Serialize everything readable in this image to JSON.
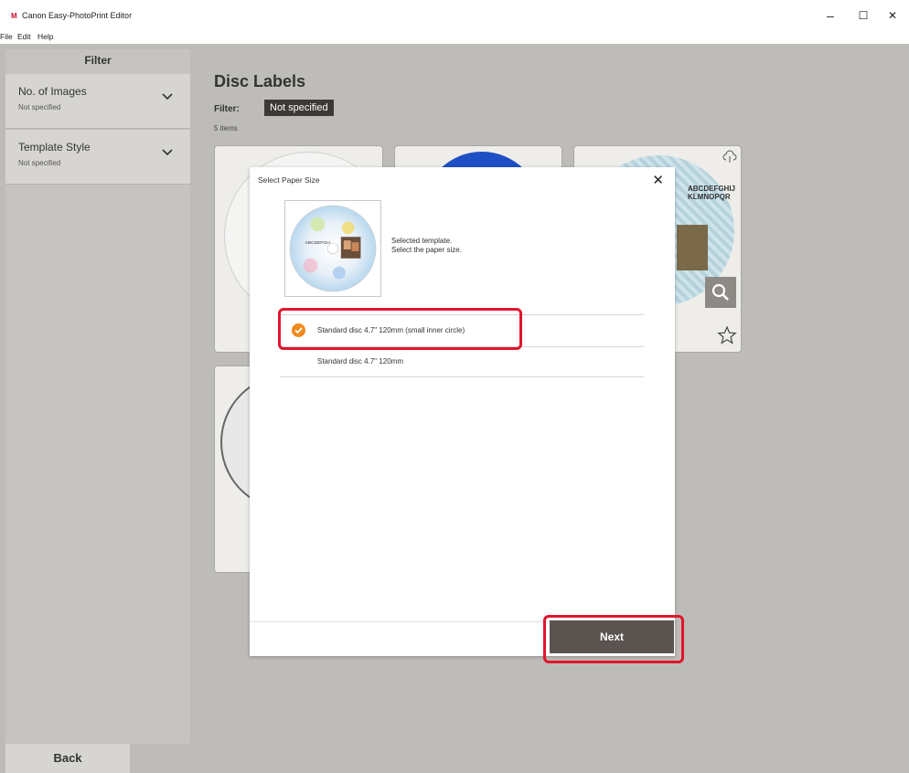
{
  "window": {
    "logo": "M",
    "title": "Canon Easy-PhotoPrint Editor",
    "minimize": "–",
    "maximize": "☐",
    "close": "✕"
  },
  "menu": [
    "File",
    "Edit",
    "Help"
  ],
  "sidebar": {
    "heading": "Filter",
    "filters": [
      {
        "title": "No. of Images",
        "value": "Not specified"
      },
      {
        "title": "Template Style",
        "value": "Not specified"
      }
    ]
  },
  "content": {
    "title": "Disc Labels",
    "filter_label": "Filter:",
    "filter_value": "Not specified",
    "count": "5 items"
  },
  "card_text": {
    "label_a": "ABCDEFGHIJ",
    "label_b": "KLMNOPQR"
  },
  "bottom": {
    "back": "Back"
  },
  "modal": {
    "title": "Select Paper Size",
    "close": "✕",
    "thumb_text": "ABCDEFGH",
    "message_line1": "Selected template.",
    "message_line2": "Select the paper size.",
    "options": [
      {
        "label": "Standard disc 4.7\" 120mm (small inner circle)",
        "selected": true
      },
      {
        "label": "Standard disc 4.7\" 120mm",
        "selected": false
      }
    ],
    "next": "Next"
  },
  "colors": {
    "accent_orange": "#ef8a1e",
    "highlight_red": "#e0152d",
    "button_dark": "#5a534f"
  }
}
